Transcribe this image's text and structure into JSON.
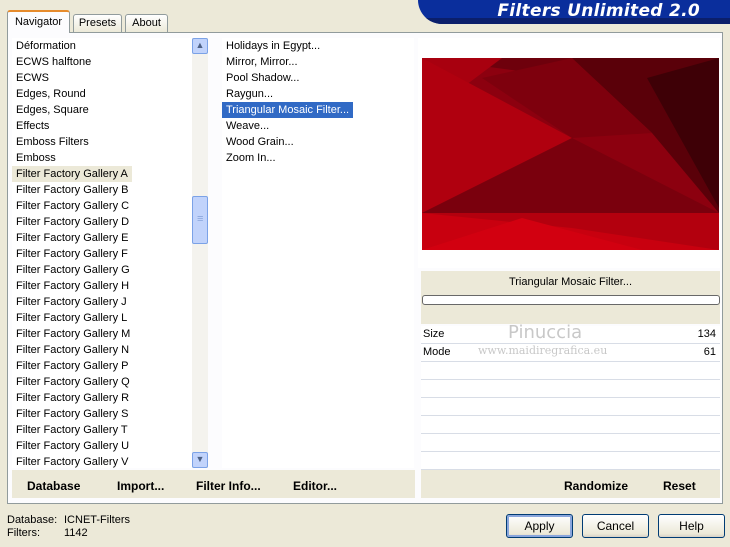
{
  "tabs": [
    "Navigator",
    "Presets",
    "About"
  ],
  "banner": "Filters Unlimited 2.0",
  "categories": [
    "Déformation",
    "ECWS halftone",
    "ECWS",
    "Edges, Round",
    "Edges, Square",
    "Effects",
    "Emboss Filters",
    "Emboss",
    "Filter Factory Gallery A",
    "Filter Factory Gallery B",
    "Filter Factory Gallery C",
    "Filter Factory Gallery D",
    "Filter Factory Gallery E",
    "Filter Factory Gallery F",
    "Filter Factory Gallery G",
    "Filter Factory Gallery H",
    "Filter Factory Gallery J",
    "Filter Factory Gallery L",
    "Filter Factory Gallery M",
    "Filter Factory Gallery N",
    "Filter Factory Gallery P",
    "Filter Factory Gallery Q",
    "Filter Factory Gallery R",
    "Filter Factory Gallery S",
    "Filter Factory Gallery T",
    "Filter Factory Gallery U",
    "Filter Factory Gallery V"
  ],
  "selected_category": "Filter Factory Gallery A",
  "filters": [
    "Holidays in Egypt...",
    "Mirror, Mirror...",
    "Pool Shadow...",
    "Raygun...",
    "Triangular Mosaic Filter...",
    "Weave...",
    "Wood Grain...",
    "Zoom In..."
  ],
  "selected_filter": "Triangular Mosaic Filter...",
  "filter_title": "Triangular Mosaic Filter...",
  "params": [
    {
      "label": "Size",
      "value": "134"
    },
    {
      "label": "Mode",
      "value": "61"
    }
  ],
  "watermark": {
    "line1": "Pinuccia",
    "line2": "www.maidiregrafica.eu"
  },
  "toolbar": {
    "database": "Database",
    "import": "Import...",
    "filter_info": "Filter Info...",
    "editor": "Editor...",
    "randomize": "Randomize",
    "reset": "Reset"
  },
  "status": {
    "database_label": "Database:",
    "database_value": "ICNET-Filters",
    "filters_label": "Filters:",
    "filters_value": "1142"
  },
  "buttons": {
    "apply": "Apply",
    "cancel": "Cancel",
    "help": "Help"
  },
  "colors": {
    "preview_dark": "#4a0008",
    "preview_mid": "#8c000f",
    "preview_bright": "#c8000f",
    "selection": "#316ac5"
  }
}
